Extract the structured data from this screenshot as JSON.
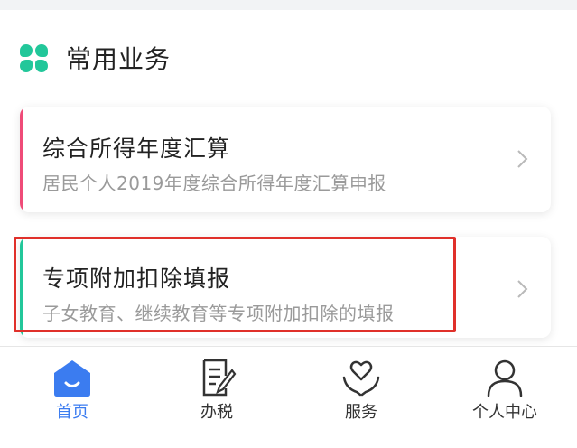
{
  "section": {
    "title": "常用业务",
    "icon": "grid-icon"
  },
  "cards": [
    {
      "title": "综合所得年度汇算",
      "subtitle": "居民个人2019年度综合所得年度汇算申报",
      "accent_color": "#ef4b78"
    },
    {
      "title": "专项附加扣除填报",
      "subtitle": "子女教育、继续教育等专项附加扣除的填报",
      "accent_color": "#22c79a"
    }
  ],
  "tabbar": {
    "active_color": "#3b7cf0",
    "items": [
      {
        "label": "首页",
        "icon": "home-icon",
        "active": true
      },
      {
        "label": "办税",
        "icon": "document-edit-icon",
        "active": false
      },
      {
        "label": "服务",
        "icon": "heart-hands-icon",
        "active": false
      },
      {
        "label": "个人中心",
        "icon": "person-icon",
        "active": false
      }
    ]
  },
  "highlight_color": "#e0302a"
}
